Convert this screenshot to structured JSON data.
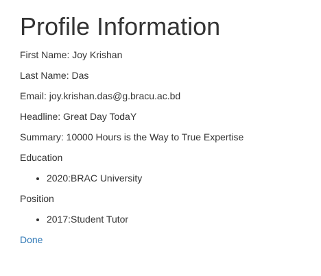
{
  "page": {
    "title": "Profile Information"
  },
  "profile": {
    "first_name": "First Name: Joy Krishan",
    "last_name": "Last Name: Das",
    "email": "Email: joy.krishan.das@g.bracu.ac.bd",
    "headline": "Headline: Great Day TodaY",
    "summary": "Summary: 10000 Hours is the Way to True Expertise"
  },
  "education": {
    "heading": "Education",
    "items": [
      "2020:BRAC University"
    ]
  },
  "position": {
    "heading": "Position",
    "items": [
      "2017:Student Tutor"
    ]
  },
  "actions": {
    "done_label": "Done"
  },
  "colors": {
    "text": "#333333",
    "link": "#337ab7"
  }
}
